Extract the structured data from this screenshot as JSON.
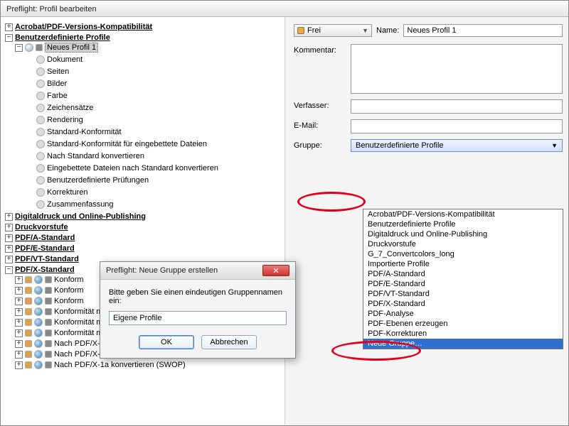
{
  "window": {
    "title": "Preflight: Profil bearbeiten"
  },
  "tree": {
    "cat_acrobat": "Acrobat/PDF-Versions-Kompatibilität",
    "cat_user": "Benutzerdefinierte Profile",
    "profile": "Neues Profil 1",
    "sub": [
      "Dokument",
      "Seiten",
      "Bilder",
      "Farbe",
      "Zeichensätze",
      "Rendering",
      "Standard-Konformität",
      "Standard-Konformität für eingebettete Dateien",
      "Nach Standard konvertieren",
      "Eingebettete Dateien nach Standard konvertieren",
      "Benutzerdefinierte Prüfungen",
      "Korrekturen",
      "Zusammenfassung"
    ],
    "cat_digital": "Digitaldruck und Online-Publishing",
    "cat_druck": "Druckvorstufe",
    "cat_pdfa": "PDF/A-Standard",
    "cat_pdfe": "PDF/E-Standard",
    "cat_pdfvt": "PDF/VT-Standard",
    "cat_pdfx": "PDF/X-Standard",
    "pdfx": [
      "Konformität mit PDF/X-4p prüfen",
      "Konformität mit PDF/X-5g prüfen",
      "Konformität mit PDF/X-5pg prüfen",
      "Nach PDF/X-1a konvertieren (Coated FOGRA39)",
      "Nach PDF/X-1a konvertieren (Japan Color Coated)",
      "Nach PDF/X-1a konvertieren (SWOP)"
    ],
    "pdfx_short": [
      "Konform",
      "Konform",
      "Konform"
    ]
  },
  "right": {
    "lock": "Frei",
    "name_label": "Name:",
    "name_value": "Neues Profil 1",
    "kommentar_label": "Kommentar:",
    "verfasser_label": "Verfasser:",
    "email_label": "E-Mail:",
    "gruppe_label": "Gruppe:",
    "gruppe_value": "Benutzerdefinierte Profile"
  },
  "dropdown": [
    "Acrobat/PDF-Versions-Kompatibilität",
    "Benutzerdefinierte Profile",
    "Digitaldruck und Online-Publishing",
    "Druckvorstufe",
    "G_7_Convertcolors_long",
    "Importierte Profile",
    "PDF/A-Standard",
    "PDF/E-Standard",
    "PDF/VT-Standard",
    "PDF/X-Standard",
    "PDF-Analyse",
    "PDF-Ebenen erzeugen",
    "PDF-Korrekturen",
    "Neue Gruppe…"
  ],
  "modal": {
    "title": "Preflight: Neue Gruppe erstellen",
    "prompt": "Bitte geben Sie einen eindeutigen Gruppennamen ein:",
    "value": "Eigene Profile",
    "ok": "OK",
    "cancel": "Abbrechen"
  }
}
